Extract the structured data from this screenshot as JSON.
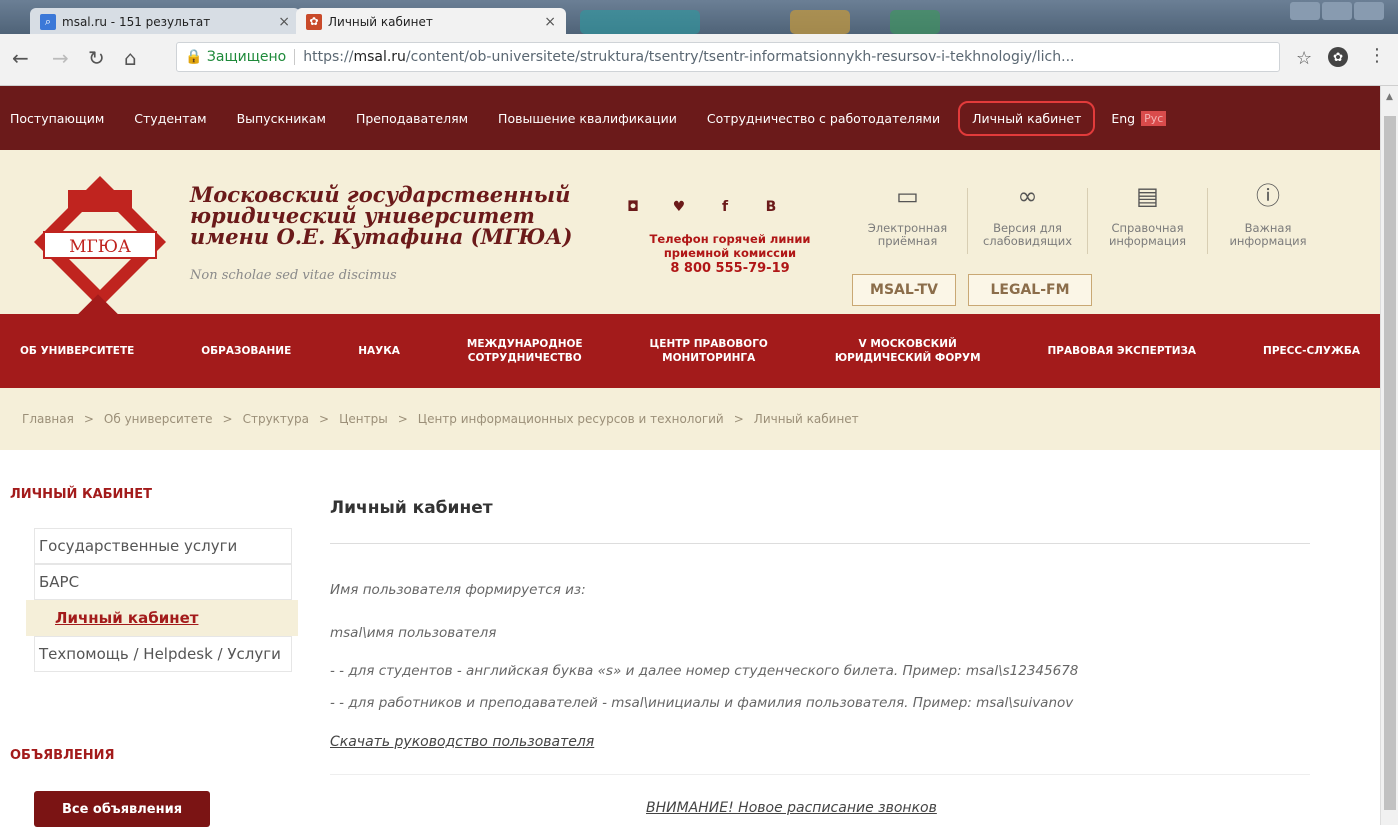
{
  "browser": {
    "tabs": [
      {
        "title": "msal.ru - 151 результат",
        "favicon": "search-icon"
      },
      {
        "title": "Личный кабинет",
        "favicon": "site-favicon"
      }
    ],
    "secure_label": "Защищено",
    "url_prefix": "https://",
    "url_domain": "msal.ru",
    "url_path": "/content/ob-universitete/struktura/tsentry/tsentr-informatsionnykh-resursov-i-tekhnologiy/lich..."
  },
  "topnav": {
    "items": [
      "Поступающим",
      "Студентам",
      "Выпускникам",
      "Преподавателям",
      "Повышение квалификации",
      "Сотрудничество с работодателями"
    ],
    "cabinet": "Личный кабинет",
    "eng": "Eng",
    "rus": "Рус"
  },
  "header": {
    "logo_text": "МГЮА",
    "name_line1": "Московский государственный",
    "name_line2": "юридический университет",
    "name_line3": "имени О.Е. Кутафина (МГЮА)",
    "motto": "Non scholae sed vitae discimus",
    "social": [
      "instagram",
      "twitter",
      "facebook",
      "vk"
    ],
    "social_glyphs": [
      "◘",
      "♥",
      "f",
      "B"
    ],
    "hotline_line1": "Телефон горячей линии",
    "hotline_line2": "приемной комиссии",
    "hotline_number": "8 800 555-79-19",
    "info": [
      {
        "icon": "monitor-icon",
        "label1": "Электронная",
        "label2": "приёмная"
      },
      {
        "icon": "glasses-icon",
        "label1": "Версия для",
        "label2": "слабовидящих"
      },
      {
        "icon": "book-icon",
        "label1": "Справочная",
        "label2": "информация"
      },
      {
        "icon": "info-icon",
        "label1": "Важная",
        "label2": "информация"
      }
    ],
    "tv": "MSAL-TV",
    "fm": "LEGAL-FM"
  },
  "mainnav": {
    "items": [
      {
        "l1": "ОБ УНИВЕРСИТЕТЕ",
        "l2": ""
      },
      {
        "l1": "ОБРАЗОВАНИЕ",
        "l2": ""
      },
      {
        "l1": "НАУКА",
        "l2": ""
      },
      {
        "l1": "МЕЖДУНАРОДНОЕ",
        "l2": "СОТРУДНИЧЕСТВО"
      },
      {
        "l1": "ЦЕНТР ПРАВОВОГО",
        "l2": "МОНИТОРИНГА"
      },
      {
        "l1": "V МОСКОВСКИЙ",
        "l2": "ЮРИДИЧЕСКИЙ ФОРУМ"
      },
      {
        "l1": "ПРАВОВАЯ ЭКСПЕРТИЗА",
        "l2": ""
      },
      {
        "l1": "ПРЕСС-СЛУЖБА",
        "l2": ""
      }
    ]
  },
  "breadcrumb": [
    "Главная",
    "Об университете",
    "Структура",
    "Центры",
    "Центр информационных ресурсов и технологий",
    "Личный кабинет"
  ],
  "breadcrumb_sep": ">",
  "sidebar": {
    "title": "ЛИЧНЫЙ КАБИНЕТ",
    "items": [
      {
        "label": "Государственные услуги"
      },
      {
        "label": "БАРС"
      },
      {
        "label": "Личный кабинет"
      },
      {
        "label": "Техпомощь / Helpdesk / Услуги"
      }
    ],
    "announcements_title": "ОБЪЯВЛЕНИЯ",
    "all_announcements": "Все объявления"
  },
  "content": {
    "title": "Личный кабинет",
    "line1": "Имя пользователя формируется из:",
    "line2": "msal\\имя пользователя",
    "line3": "- - для студентов - английская буква «s» и далее номер студенческого билета. Пример: msal\\s12345678",
    "line4": "- - для работников и преподавателей - msal\\инициалы и фамилия пользователя. Пример: msal\\suivanov",
    "download": "Скачать руководство пользователя",
    "attention": "ВНИМАНИЕ! Новое расписание звонков"
  },
  "colors": {
    "topnav_bg": "#6b1a1a",
    "mainnav_bg": "#a31b1b",
    "header_bg": "#f5efd9",
    "accent": "#a31b1b"
  }
}
